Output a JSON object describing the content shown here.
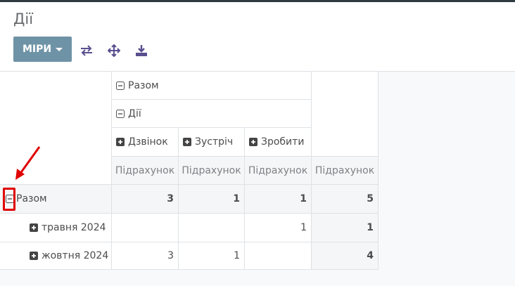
{
  "header": {
    "title": "Дії",
    "measures_label": "МІРИ"
  },
  "pivot": {
    "col_total_label": "Разом",
    "col_group_label": "Дії",
    "col_types": [
      "Дзвінок",
      "Зустріч",
      "Зробити"
    ],
    "measure_label": "Підрахунок",
    "rows": [
      {
        "label": "Разом",
        "values": [
          "3",
          "1",
          "1",
          "5"
        ]
      },
      {
        "label": "травня 2024",
        "values": [
          "",
          "",
          "1",
          "1"
        ]
      },
      {
        "label": "жовтня 2024",
        "values": [
          "3",
          "1",
          "",
          "4"
        ]
      }
    ]
  },
  "colors": {
    "accent": "#6f93a6",
    "annotation": "#e00000"
  }
}
